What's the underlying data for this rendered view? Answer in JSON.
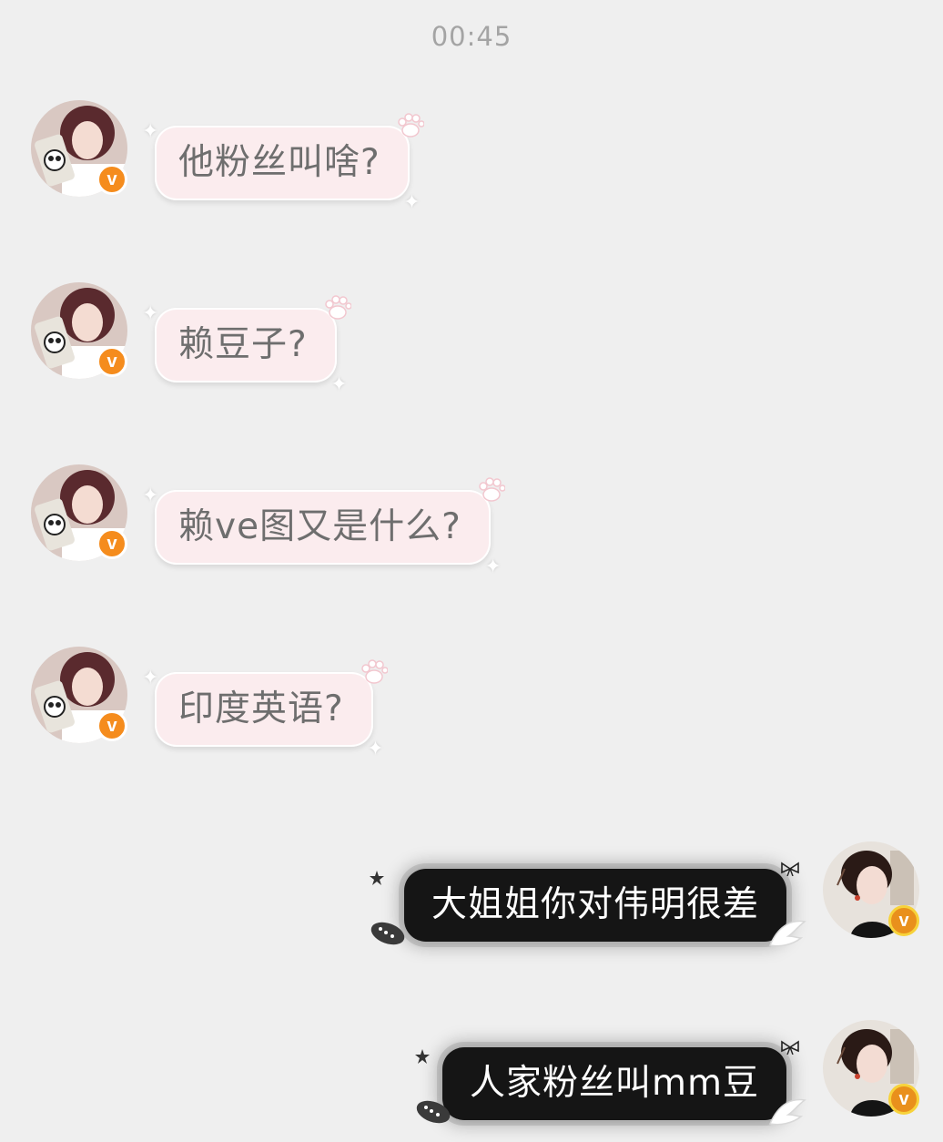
{
  "timestamp": "00:45",
  "messages": [
    {
      "side": "left",
      "text": "他粉丝叫啥?"
    },
    {
      "side": "left",
      "text": "赖豆子?"
    },
    {
      "side": "left",
      "text": "赖ve图又是什么?"
    },
    {
      "side": "left",
      "text": "印度英语?"
    },
    {
      "side": "right",
      "text": "大姐姐你对伟明很差"
    },
    {
      "side": "right",
      "text": "人家粉丝叫mm豆"
    }
  ],
  "badges": {
    "verified_glyph": "v"
  },
  "colors": {
    "background": "#efefef",
    "pink_bubble": "#fbecee",
    "dark_bubble": "#151515",
    "badge_orange": "#f58c1d",
    "timestamp_text": "#a4a4a4"
  },
  "icons": [
    "paw-icon",
    "sparkle-icon",
    "bow-icon",
    "star-icon",
    "feather-icon",
    "wing-icon",
    "verified-badge"
  ]
}
